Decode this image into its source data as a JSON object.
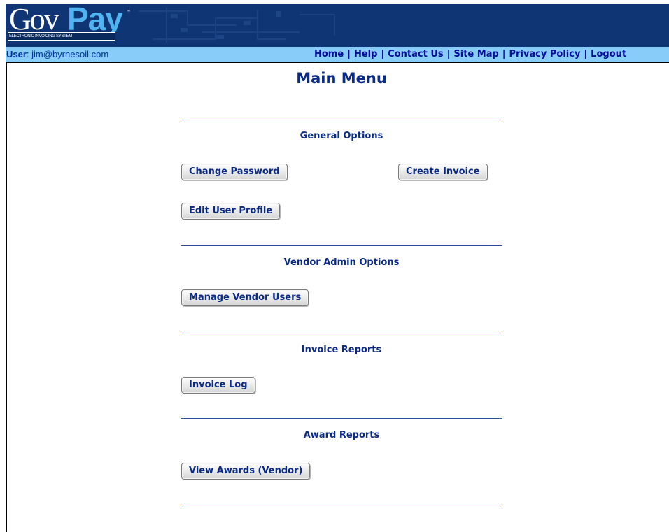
{
  "header": {
    "logo_gov": "Gov",
    "logo_pay": "Pay",
    "logo_tm": "™",
    "logo_subtitle": "ELECTRONIC INVOICING SYSTEM"
  },
  "navbar": {
    "user_label": "User",
    "user_value": ": jim@byrnesoil.com",
    "links": [
      "Home",
      "Help",
      "Contact Us",
      "Site Map",
      "Privacy Policy",
      "Logout"
    ],
    "separator": "|"
  },
  "main": {
    "title": "Main Menu",
    "sections": [
      {
        "title": "General Options",
        "buttons": [
          "Change Password",
          "Create Invoice",
          "Edit User Profile"
        ]
      },
      {
        "title": "Vendor Admin Options",
        "buttons": [
          "Manage Vendor Users"
        ]
      },
      {
        "title": "Invoice Reports",
        "buttons": [
          "Invoice Log"
        ]
      },
      {
        "title": "Award Reports",
        "buttons": [
          "View Awards (Vendor)"
        ]
      }
    ]
  },
  "colors": {
    "banner": "#103574",
    "navbar": "#88ccfa",
    "heading_text": "#0a2a84",
    "link_text": "#000c99"
  }
}
